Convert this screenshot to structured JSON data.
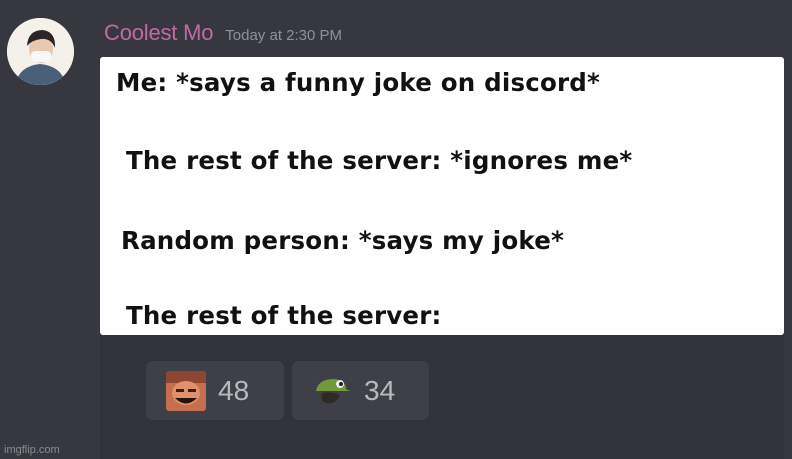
{
  "message": {
    "author": "Coolest Mo",
    "timestamp": "Today at 2:30 PM"
  },
  "meme": {
    "lines": [
      "Me: *says a funny joke on discord*",
      "The rest of the server: *ignores me*",
      "Random person: *says my joke*",
      "The rest of the server:"
    ]
  },
  "reactions": [
    {
      "emoji": "laughing-face-emoji",
      "count": "48"
    },
    {
      "emoji": "green-hat-frog-emoji",
      "count": "34"
    }
  ],
  "watermark": "imgflip.com",
  "colors": {
    "background": "#37383f",
    "username": "#c06aa4",
    "timestamp": "#8f9197",
    "reaction_bg": "#3f4047"
  }
}
